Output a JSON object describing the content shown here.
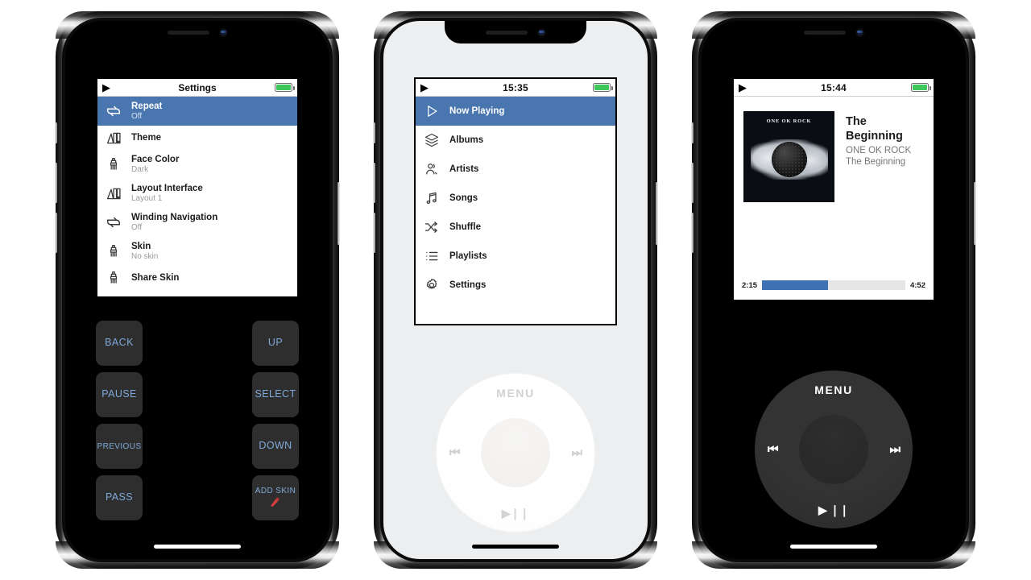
{
  "theme": {
    "accent_blue": "#4a76b0",
    "progress_blue": "#3f72b4",
    "battery_green": "#3ec75a",
    "key_text_blue": "#7fa8d8",
    "key_bg": "#2e2e2e",
    "screen_light_bg": "#eceef0"
  },
  "phone1": {
    "screen_bg": "black",
    "status": {
      "play_glyph": "▶",
      "title": "Settings",
      "battery_icon": "battery-icon"
    },
    "settings_rows": [
      {
        "icon": "repeat-icon",
        "label": "Repeat",
        "sub": "Off",
        "selected": true
      },
      {
        "icon": "palette-icon",
        "label": "Theme",
        "sub": "",
        "selected": false
      },
      {
        "icon": "brush-icon",
        "label": "Face Color",
        "sub": "Dark",
        "selected": false
      },
      {
        "icon": "palette-icon",
        "label": "Layout Interface",
        "sub": "Layout 1",
        "selected": false
      },
      {
        "icon": "repeat-icon",
        "label": "Winding Navigation",
        "sub": "Off",
        "selected": false
      },
      {
        "icon": "brush-icon",
        "label": "Skin",
        "sub": "No skin",
        "selected": false
      },
      {
        "icon": "brush-icon",
        "label": "Share Skin",
        "sub": "",
        "selected": false
      }
    ],
    "keys": [
      [
        {
          "label": "BACK",
          "icon": ""
        },
        {
          "label": "UP",
          "icon": ""
        }
      ],
      [
        {
          "label": "PAUSE",
          "icon": ""
        },
        {
          "label": "SELECT",
          "icon": ""
        }
      ],
      [
        {
          "label": "PREVIOUS",
          "icon": ""
        },
        {
          "label": "DOWN",
          "icon": ""
        }
      ],
      [
        {
          "label": "PASS",
          "icon": ""
        },
        {
          "label": "ADD SKIN",
          "icon": "pencil-icon"
        }
      ]
    ]
  },
  "phone2": {
    "screen_bg": "light",
    "status": {
      "play_glyph": "▶",
      "clock": "15:35",
      "battery_icon": "battery-icon"
    },
    "menu_rows": [
      {
        "icon": "play-triangle-icon",
        "label": "Now Playing",
        "selected": true
      },
      {
        "icon": "albums-stack-icon",
        "label": "Albums",
        "selected": false
      },
      {
        "icon": "artists-icon",
        "label": "Artists",
        "selected": false
      },
      {
        "icon": "music-note-icon",
        "label": "Songs",
        "selected": false
      },
      {
        "icon": "shuffle-icon",
        "label": "Shuffle",
        "selected": false
      },
      {
        "icon": "playlist-icon",
        "label": "Playlists",
        "selected": false
      },
      {
        "icon": "gear-icon",
        "label": "Settings",
        "selected": false
      }
    ],
    "wheel": {
      "menu": "MENU",
      "prev": "⏮",
      "next": "⏭",
      "playpause": "▶❘❘"
    }
  },
  "phone3": {
    "screen_bg": "black",
    "status": {
      "play_glyph": "▶",
      "clock": "15:44",
      "battery_icon": "battery-icon"
    },
    "now_playing": {
      "art_title": "ONE OK ROCK",
      "title": "The Beginning",
      "artist": "ONE OK ROCK",
      "album": "The Beginning",
      "elapsed": "2:15",
      "duration": "4:52",
      "progress_percent": 46
    },
    "wheel": {
      "menu": "MENU",
      "prev": "⏮",
      "next": "⏭",
      "playpause": "▶ ❘❘"
    }
  }
}
